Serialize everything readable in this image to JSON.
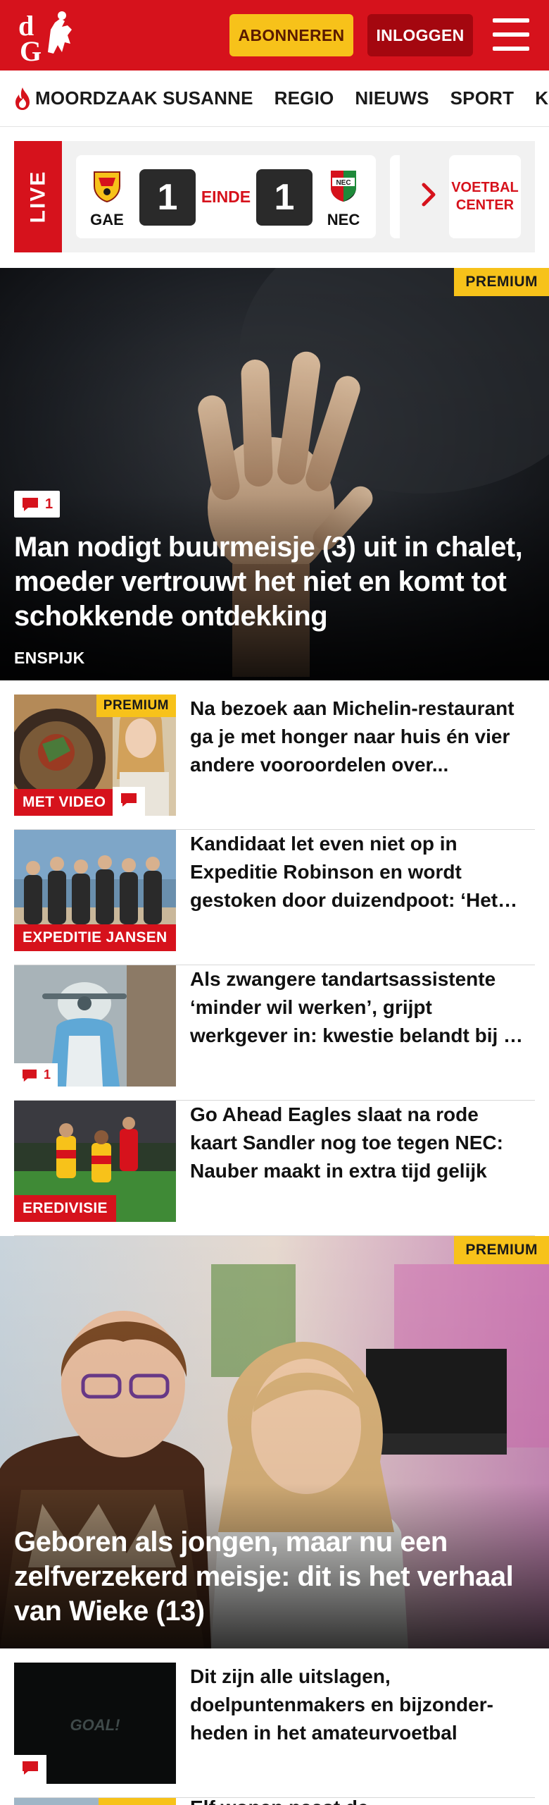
{
  "header": {
    "logo_text": "dG",
    "subscribe_label": "ABONNEREN",
    "login_label": "INLOGGEN",
    "brand_color": "#d6121c",
    "accent_color": "#f7c21a"
  },
  "nav": {
    "items": [
      {
        "label": "MOORDZAAK SUSANNE",
        "icon": "flame-icon"
      },
      {
        "label": "REGIO"
      },
      {
        "label": "NIEUWS"
      },
      {
        "label": "SPORT"
      },
      {
        "label": "KIJK"
      }
    ]
  },
  "live": {
    "tag": "LIVE",
    "home_team": "GAE",
    "away_team": "NEC",
    "home_score": "1",
    "away_score": "1",
    "status": "EINDE",
    "voetbal_center": "VOETBAL CENTER"
  },
  "hero1": {
    "premium": "PREMIUM",
    "comments": "1",
    "title": "Man nodigt buurmeisje (3) uit in chalet, moeder vertrouwt het niet en komt tot schokkende ontdekking",
    "location": "ENSPIJK"
  },
  "articles": [
    {
      "title": "Na bezoek aan Michelin-restaurant ga je met honger naar huis én vier andere vooroordelen over...",
      "label": "MET VIDEO",
      "premium": "PREMIUM",
      "has_comment": true
    },
    {
      "title": "Kandidaat let even niet op in Expeditie Robinson en wordt gestoken door duizendpoot: ‘Het brandde...",
      "label": "EXPEDITIE JANSEN"
    },
    {
      "title": "Als zwangere tandartsassistente ‘minder wil werken’, grijpt werkgever in: kwestie belandt bij de rechter",
      "comments": "1"
    },
    {
      "title": "Go Ahead Eagles slaat na rode kaart Sandler nog toe tegen NEC: Nauber maakt in extra tijd gelijk",
      "label": "EREDIVISIE"
    }
  ],
  "hero2": {
    "premium": "PREMIUM",
    "title": "Geboren als jongen, maar nu een zelfverzekerd meisje: dit is het verhaal van Wieke (13)"
  },
  "articles2": [
    {
      "title": "Dit zijn alle uitslagen, doelpuntenmakers en bijzonder-heden in het amateurvoetbal",
      "thumb_text": "GOAL!",
      "has_comment": true
    }
  ],
  "partial": {
    "premium": "PREMIUM",
    "title": "Elf wonen naast de..."
  }
}
